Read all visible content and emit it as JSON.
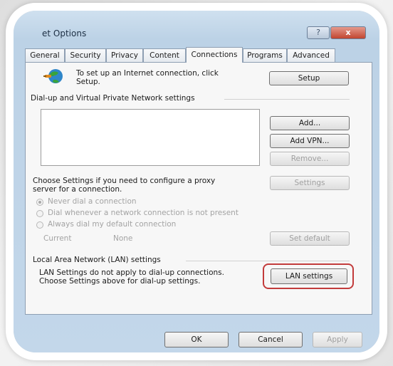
{
  "window": {
    "title": "et Options",
    "help_label": "?",
    "close_label": "x"
  },
  "tabs": [
    {
      "label": "General"
    },
    {
      "label": "Security"
    },
    {
      "label": "Privacy"
    },
    {
      "label": "Content"
    },
    {
      "label": "Connections",
      "active": true
    },
    {
      "label": "Programs"
    },
    {
      "label": "Advanced"
    }
  ],
  "setup": {
    "text_line1": "To set up an Internet connection, click",
    "text_line2": "Setup.",
    "button_label": "Setup"
  },
  "dialup": {
    "group_label": "Dial-up and Virtual Private Network settings",
    "add_label": "Add...",
    "add_vpn_label": "Add VPN...",
    "remove_label": "Remove...",
    "settings_label": "Settings",
    "proxy_text_line1": "Choose Settings if you need to configure a proxy",
    "proxy_text_line2": "server for a connection.",
    "radio_options": [
      {
        "label": "Never dial a connection",
        "checked": true
      },
      {
        "label": "Dial whenever a network connection is not present",
        "checked": false
      },
      {
        "label": "Always dial my default connection",
        "checked": false
      }
    ],
    "current_label": "Current",
    "current_value": "None",
    "set_default_label": "Set default"
  },
  "lan": {
    "group_label": "Local Area Network (LAN) settings",
    "text_line1": "LAN Settings do not apply to dial-up connections.",
    "text_line2": "Choose Settings above for dial-up settings.",
    "button_label": "LAN settings"
  },
  "footer": {
    "ok_label": "OK",
    "cancel_label": "Cancel",
    "apply_label": "Apply"
  },
  "colors": {
    "highlight": "#c23b3b",
    "titlebar": "#c6d8ea"
  }
}
